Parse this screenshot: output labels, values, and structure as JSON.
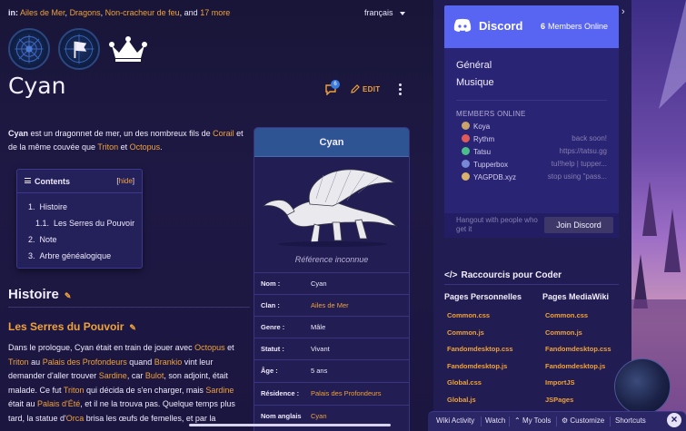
{
  "categories": {
    "prefix": "in:",
    "links": [
      "Ailes de Mer",
      "Dragons",
      "Non-cracheur de feu"
    ],
    "sep1": ", ",
    "sep2": ", ",
    "sep3": ", and ",
    "more": "17 more"
  },
  "language": "français",
  "page": {
    "title": "Cyan",
    "comment_count": "6",
    "edit_label": "EDIT"
  },
  "intro": {
    "name": "Cyan",
    "t1": " est un dragonnet de mer, un des nombreux fils de ",
    "l1": "Corail",
    "t2": " et de la même couvée que ",
    "l2": "Triton",
    "t3": " et ",
    "l3": "Octopus",
    "t4": "."
  },
  "toc": {
    "title": "Contents",
    "hide_open": "[",
    "hide": "hide",
    "hide_close": "]",
    "items": [
      {
        "num": "1.",
        "label": "Histoire"
      },
      {
        "num": "1.1.",
        "label": "Les Serres du Pouvoir"
      },
      {
        "num": "2.",
        "label": "Note"
      },
      {
        "num": "3.",
        "label": "Arbre généalogique"
      }
    ]
  },
  "section": {
    "h2": "Histoire",
    "h3": "Les Serres du Pouvoir"
  },
  "story": {
    "s1": "Dans le prologue, Cyan était en train de jouer avec ",
    "l1": "Octopus",
    "s2": " et ",
    "l2": "Triton",
    "s3": " au ",
    "l3": "Palais des Profondeurs",
    "s4": " quand ",
    "l4": "Brankio",
    "s5": " vint leur demander d'aller trouver ",
    "l5": "Sardine",
    "s6": ", car ",
    "l6": "Bulot",
    "s7": ", son adjoint, était malade. Ce fut ",
    "l7": "Triton",
    "s8": " qui décida de s'en charger, mais ",
    "l8": "Sardine",
    "s9": " était au ",
    "l9": "Palais d'Été",
    "s10": ", et il ne la trouva pas. Quelque temps plus tard, la statue d'",
    "l10": "Orca",
    "s11": " brisa les œufs de femelles, et par la"
  },
  "infobox": {
    "title": "Cyan",
    "caption": "Référence inconnue",
    "rows": [
      {
        "key": "Nom :",
        "value": "Cyan",
        "link": false
      },
      {
        "key": "Clan :",
        "value": "Ailes de Mer",
        "link": true
      },
      {
        "key": "Genre :",
        "value": "Mâle",
        "link": false
      },
      {
        "key": "Statut :",
        "value": "Vivant",
        "link": false
      },
      {
        "key": "Âge :",
        "value": "5 ans",
        "link": false
      },
      {
        "key": "Résidence :",
        "value": "Palais des Profondeurs",
        "link": true
      },
      {
        "key": "Nom anglais",
        "value": "Cyan",
        "link": true
      }
    ]
  },
  "discord": {
    "name": "Discord",
    "online_count": "6",
    "online_label": "Members Online",
    "channels": [
      "Général",
      "Musique"
    ],
    "members_heading": "MEMBERS ONLINE",
    "members": [
      {
        "name": "Koya",
        "status": "",
        "color": "#c9a36a"
      },
      {
        "name": "Rythm",
        "status": "back soon!",
        "color": "#e05a5a"
      },
      {
        "name": "Tatsu",
        "status": "https://tatsu.gg",
        "color": "#4bbf8a"
      },
      {
        "name": "Tupperbox",
        "status": "tul!help | tupper...",
        "color": "#7a86d6"
      },
      {
        "name": "YAGPDB.xyz",
        "status": "stop using \"pass...",
        "color": "#d8b26a"
      }
    ],
    "hangout": "Hangout with people who get it",
    "join": "Join Discord"
  },
  "coder": {
    "title": "Raccourcis pour Coder",
    "col1_head": "Pages Personnelles",
    "col2_head": "Pages MediaWiki",
    "col1": [
      "Common.css",
      "Common.js",
      "Fandomdesktop.css",
      "Fandomdesktop.js",
      "Global.css",
      "Global.js"
    ],
    "col2": [
      "Common.css",
      "Common.js",
      "Fandomdesktop.css",
      "Fandomdesktop.js",
      "ImportJS",
      "JSPages"
    ]
  },
  "toolbar": {
    "wiki_activity": "Wiki Activity",
    "watch": "Watch",
    "my_tools": "My Tools",
    "customize": "Customize",
    "shortcuts": "Shortcuts"
  },
  "colors": {
    "accent": "#f0a23a",
    "background": "#1e1944",
    "infobox_header": "#2f5494",
    "discord_brand": "#5865f2"
  },
  "icons": {
    "badges": [
      "blue-badge-icon",
      "flag-badge-icon",
      "crown-icon"
    ],
    "comment": "speech-bubble-icon",
    "edit": "pencil-icon",
    "more": "kebab-icon",
    "code": "code-brackets-icon"
  }
}
